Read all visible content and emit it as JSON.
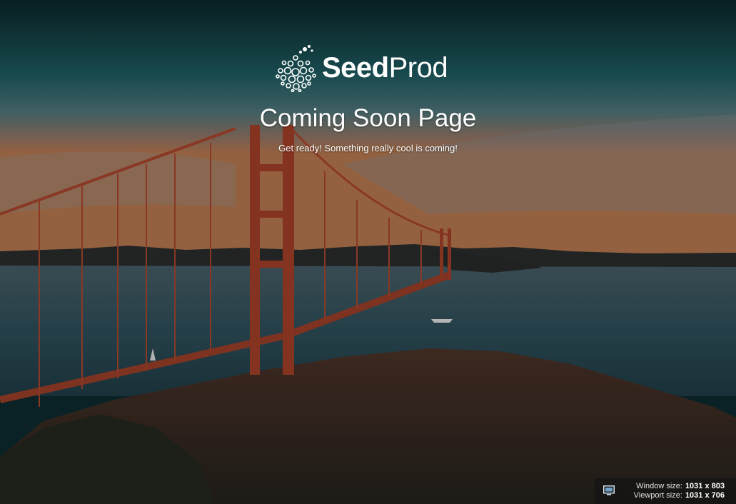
{
  "brand": {
    "logo_bold": "Seed",
    "logo_light": "Prod",
    "logo_icon": "seedprod-seed-icon"
  },
  "hero": {
    "title": "Coming Soon Page",
    "subtitle": "Get ready! Something really cool is coming!"
  },
  "size_badge": {
    "icon": "monitor-icon",
    "window_label": "Window size:",
    "window_value": "1031 x 803",
    "viewport_label": "Viewport size:",
    "viewport_value": "1031 x 706"
  },
  "colors": {
    "sky_top": "#0b2e33",
    "sky_mid": "#2b6d72",
    "sunset": "#c9774a",
    "bridge": "#b8452b",
    "water": "#3e5b66",
    "hill": "#3a2a22",
    "text": "#ffffff"
  }
}
